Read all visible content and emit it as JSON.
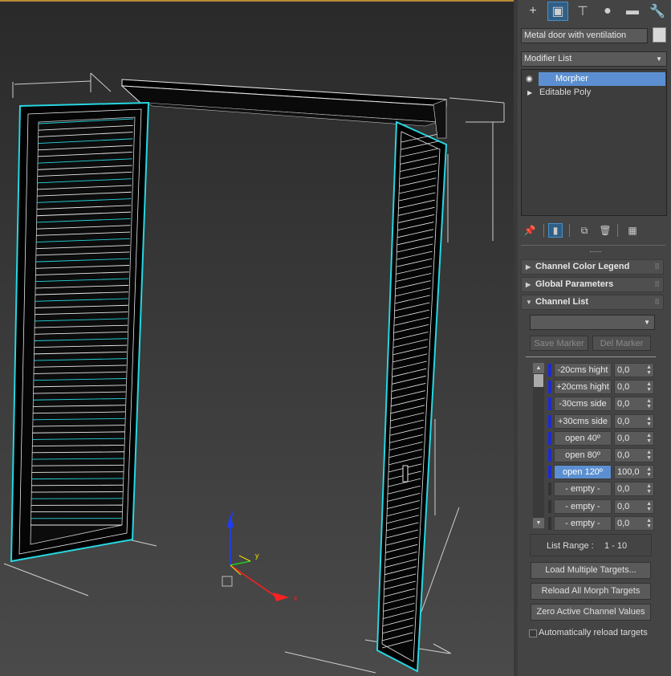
{
  "viewport": {
    "axis_labels": {
      "x": "x",
      "y": "y",
      "z": "z"
    }
  },
  "panel": {
    "tabs": [
      {
        "name": "create",
        "glyph": "+"
      },
      {
        "name": "modify",
        "glyph": "▣"
      },
      {
        "name": "hierarchy",
        "glyph": "⊤"
      },
      {
        "name": "motion",
        "glyph": "●"
      },
      {
        "name": "display",
        "glyph": "▬"
      },
      {
        "name": "utilities",
        "glyph": "🔧"
      }
    ],
    "object_name": "Metal door with ventilation",
    "object_color": "#d8d8d8",
    "modifier_list_label": "Modifier List",
    "stack": {
      "items": [
        {
          "label": "Morpher",
          "selected": true
        },
        {
          "label": "Editable Poly",
          "selected": false
        }
      ]
    },
    "rollouts": {
      "channel_color_legend": "Channel Color Legend",
      "global_parameters": "Global Parameters",
      "channel_list": "Channel List"
    },
    "markers": {
      "dropdown_value": "",
      "save_marker": "Save Marker",
      "del_marker": "Del Marker"
    },
    "channels": [
      {
        "name": "-20cms hight",
        "value": "0,0",
        "active": true,
        "selected": false
      },
      {
        "name": "+20cms hight",
        "value": "0,0",
        "active": true,
        "selected": false
      },
      {
        "name": "-30cms side",
        "value": "0,0",
        "active": true,
        "selected": false
      },
      {
        "name": "+30cms side",
        "value": "0,0",
        "active": true,
        "selected": false
      },
      {
        "name": "open 40º",
        "value": "0,0",
        "active": true,
        "selected": false
      },
      {
        "name": "open 80º",
        "value": "0,0",
        "active": true,
        "selected": false
      },
      {
        "name": "open 120º",
        "value": "100,0",
        "active": true,
        "selected": true
      },
      {
        "name": "- empty -",
        "value": "0,0",
        "active": false,
        "selected": false
      },
      {
        "name": "- empty -",
        "value": "0,0",
        "active": false,
        "selected": false
      },
      {
        "name": "- empty -",
        "value": "0,0",
        "active": false,
        "selected": false
      }
    ],
    "list_range_label": "List Range :",
    "list_range_value": "1 - 10",
    "buttons": {
      "load_multiple": "Load Multiple Targets...",
      "reload_all": "Reload All Morph Targets",
      "zero_active": "Zero Active Channel Values"
    },
    "auto_reload_label": "Automatically reload targets",
    "auto_reload_checked": false
  }
}
